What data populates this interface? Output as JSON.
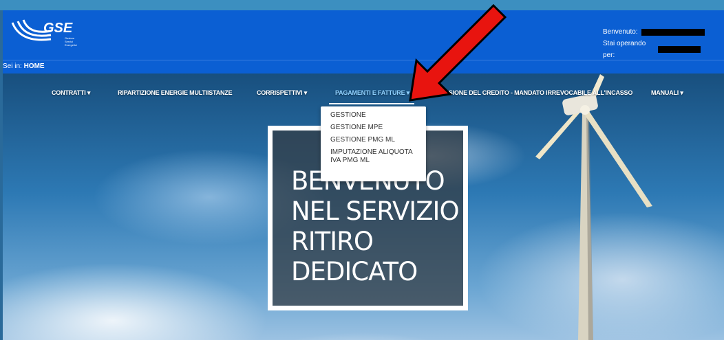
{
  "header": {
    "logo_text": "GSE",
    "logo_subtitle": "Gestore Servizi Energetici",
    "welcome_label": "Benvenuto:",
    "operating_label": "Stai operando per:"
  },
  "breadcrumb": {
    "prefix": "Sei in:",
    "current": "HOME"
  },
  "nav": {
    "items": [
      {
        "label": "CONTRATTI ▾"
      },
      {
        "label": "RIPARTIZIONE ENERGIE MULTIISTANZE"
      },
      {
        "label": "CORRISPETTIVI ▾"
      },
      {
        "label": "PAGAMENTI E FATTURE ▾"
      },
      {
        "label": "CESSIONE DEL CREDITO - MANDATO IRREVOCABILE ALL'INCASSO"
      },
      {
        "label": "MANUALI ▾"
      }
    ],
    "active_index": 3
  },
  "dropdown": {
    "items": [
      {
        "label": "GESTIONE"
      },
      {
        "label": "GESTIONE MPE"
      },
      {
        "label": "GESTIONE PMG ML"
      },
      {
        "label": "IMPUTAZIONE ALIQUOTA IVA PMG ML"
      }
    ]
  },
  "hero": {
    "line1": "BENVENUTO",
    "line2": "NEL SERVIZIO",
    "line3": "RITIRO",
    "line4": "DEDICATO"
  },
  "colors": {
    "header_blue": "#0b5fd3",
    "active_nav": "#8fd1ff",
    "arrow_red": "#e8140f"
  }
}
